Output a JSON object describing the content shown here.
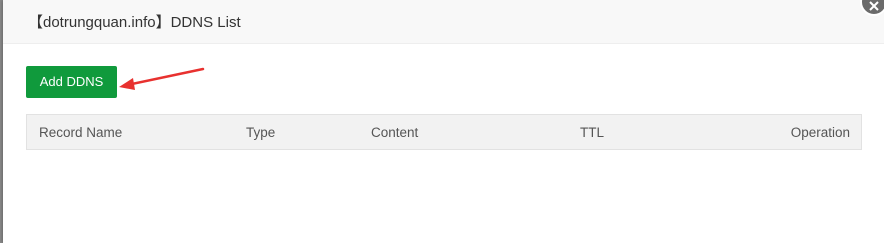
{
  "dialog": {
    "title": "【dotrungquan.info】DDNS List",
    "close_icon": "close-icon"
  },
  "toolbar": {
    "add_label": "Add DDNS",
    "annotation_arrow_color": "#e8312f"
  },
  "table": {
    "columns": [
      "Record Name",
      "Type",
      "Content",
      "TTL",
      "Operation"
    ],
    "rows": []
  },
  "colors": {
    "primary_button": "#109a3c",
    "header_bg": "#f8f8f8",
    "table_header_bg": "#f2f2f2"
  }
}
